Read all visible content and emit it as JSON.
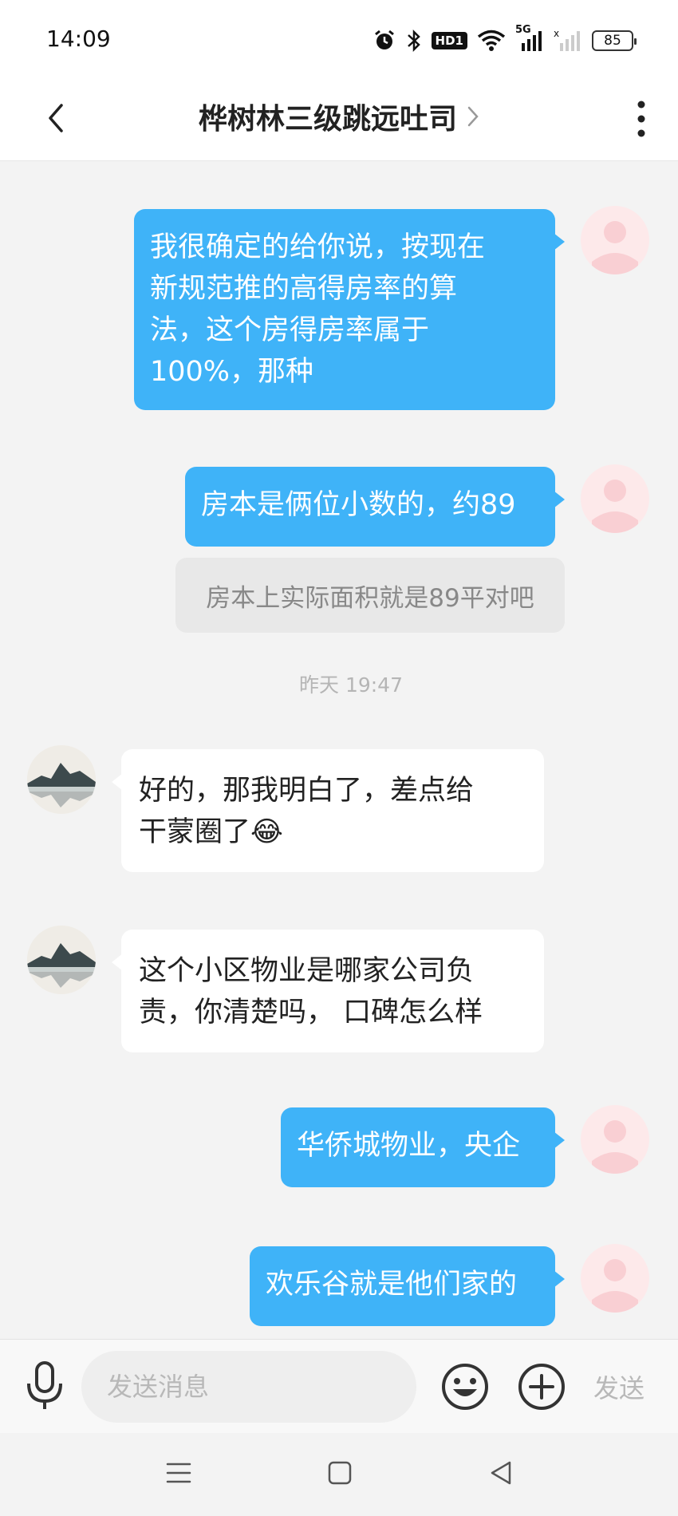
{
  "status_bar": {
    "time": "14:09",
    "hd_label": "HD1",
    "network_label": "5G",
    "battery_level": "85"
  },
  "header": {
    "title": "桦树林三级跳远吐司"
  },
  "messages": [
    {
      "sender": "self",
      "text_lines": [
        "我很确定的给你说，按现在",
        "新规范推的高得房率的算",
        "法，这个房得房率属于",
        "100%，那种"
      ]
    },
    {
      "sender": "self",
      "text": "房本是俩位小数的，约89",
      "quote": "房本上实际面积就是89平对吧"
    },
    {
      "timestamp": "昨天 19:47"
    },
    {
      "sender": "peer",
      "text_lines": [
        "好的，那我明白了，差点给",
        "干蒙圈了😂"
      ]
    },
    {
      "sender": "peer",
      "text_lines": [
        "这个小区物业是哪家公司负",
        "责，你清楚吗， 口碑怎么样"
      ]
    },
    {
      "sender": "self",
      "text": "华侨城物业，央企"
    },
    {
      "sender": "self",
      "text": "欢乐谷就是他们家的"
    }
  ],
  "input_bar": {
    "placeholder": "发送消息",
    "send_label": "发送"
  },
  "colors": {
    "outgoing_bubble": "#3fb3f8",
    "incoming_bubble": "#ffffff",
    "background": "#f3f3f3",
    "self_avatar": "#fde9ea"
  },
  "icons": {
    "back": "chevron-left-icon",
    "title_more": "chevron-right-icon",
    "menu": "more-vertical-icon",
    "mic": "microphone-icon",
    "emoji": "emoji-icon",
    "plus": "plus-circle-icon",
    "sys_menu": "menu-lines-icon",
    "sys_home": "home-square-icon",
    "sys_back": "back-triangle-icon"
  }
}
